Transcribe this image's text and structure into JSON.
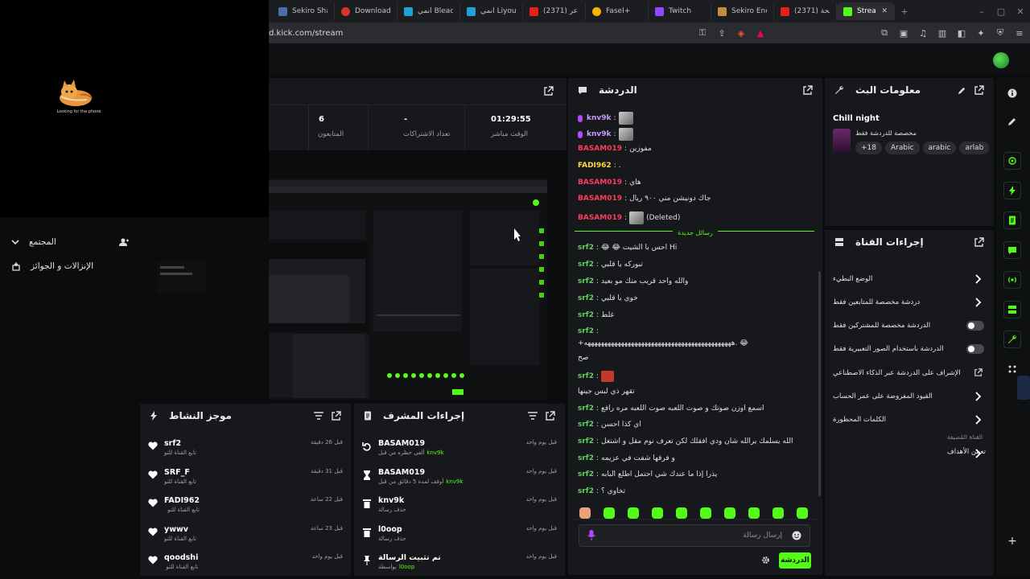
{
  "browser": {
    "tabs": [
      {
        "label": "Sekiro Shado",
        "color": "#4a6fa5"
      },
      {
        "label": "Download",
        "color": "#d9342b"
      },
      {
        "label": "انمي Bleach",
        "color": "#21a0d6"
      },
      {
        "label": "انمي Liyou)",
        "color": "#21a0d6"
      },
      {
        "label": "(2371) نكبنا عر",
        "color": "#e62117"
      },
      {
        "label": "Fasel+",
        "color": "#f4b400"
      },
      {
        "label": "Twitch",
        "color": "#9146ff"
      },
      {
        "label": "Sekiro Enemy",
        "color": "#c68d3c"
      },
      {
        "label": "(2371) واضحة",
        "color": "#e62117"
      },
      {
        "label": "Stream",
        "color": "#53fc18"
      }
    ],
    "url": "d.kick.com/stream"
  },
  "cam": {
    "caption": "Looking for the phone"
  },
  "leftnav": {
    "items": [
      {
        "label": "المجتمع"
      },
      {
        "label": "الإنزالات و الجوائز"
      }
    ]
  },
  "stats": {
    "items": [
      {
        "value": "01:29:55",
        "label": "الوقت مباشر"
      },
      {
        "value": "-",
        "label": "تعداد الاشتراكات"
      },
      {
        "value": "6",
        "label": "المتابعون"
      }
    ]
  },
  "chat": {
    "title": "الدردشة",
    "messages": [
      {
        "user": "knv9k",
        "color": "#c89cff",
        "text": "",
        "emote": true
      },
      {
        "user": "knv9k",
        "color": "#c89cff",
        "text": "",
        "emote": true
      },
      {
        "user": "BASAM019",
        "color": "#ff3b5c",
        "text": "مفوزين"
      },
      {
        "user": "FADI962",
        "color": "#ffd54a",
        "text": "."
      },
      {
        "user": "BASAM019",
        "color": "#ff3b5c",
        "text": "هاي"
      },
      {
        "user": "BASAM019",
        "color": "#ff3b5c",
        "text": "جاك دونيشن مني ٩٠٠ ريال"
      },
      {
        "user": "BASAM019",
        "color": "#ff3b5c",
        "text": "(Deleted)",
        "emote": true
      }
    ],
    "new_divider": "رسائل جديدة",
    "new_messages": [
      {
        "user": "srf2",
        "color": "#5fd35f",
        "text": "Hi احس با الشيت 😂 😂"
      },
      {
        "user": "srf2",
        "color": "#5fd35f",
        "text": "تبوركه يا قلبي"
      },
      {
        "user": "srf2",
        "color": "#5fd35f",
        "text": "والله واحد قريب منك مو بعيد"
      },
      {
        "user": "srf2",
        "color": "#5fd35f",
        "text": "خوي يا قلبي"
      },
      {
        "user": "srf2",
        "color": "#5fd35f",
        "text": "غلط"
      },
      {
        "user": "srf2",
        "color": "#5fd35f",
        "text": ""
      },
      {
        "user": "",
        "color": "#5fd35f",
        "text": "😂 .ههههههههههههههههههههههههههههههههههههههههههههه+"
      },
      {
        "user": "",
        "color": "#5fd35f",
        "text": "صح"
      },
      {
        "user": "srf2",
        "color": "#5fd35f",
        "text": "",
        "emote": true
      },
      {
        "user": "",
        "color": "#5fd35f",
        "text": "تقهر ذي لبس جينها"
      },
      {
        "user": "srf2",
        "color": "#5fd35f",
        "text": "اسمع اوزن صوتك و صوت اللعبه صوت اللعبه مره رافع"
      },
      {
        "user": "srf2",
        "color": "#5fd35f",
        "text": "اي كذا احسن"
      },
      {
        "user": "srf2",
        "color": "#5fd35f",
        "text": "الله يسلمك يرالله شان ودي افقلك لكن تعرف نوم مقل و اشتغل"
      },
      {
        "user": "srf2",
        "color": "#5fd35f",
        "text": "و فرقها شفت في عزيمه"
      },
      {
        "user": "srf2",
        "color": "#5fd35f",
        "text": "يذرا إذا ما عندك شي احتمل اطلع البابه"
      },
      {
        "user": "srf2",
        "color": "#5fd35f",
        "text": "تخاوي ؟"
      }
    ],
    "input_placeholder": "إرسال رسالة",
    "send_label": "الدردشة"
  },
  "info": {
    "title": "معلومات البث",
    "stream_title": "Chill night",
    "category": "مخصصة للدردشة فقط",
    "tags": [
      "+18",
      "Arabic",
      "arabic",
      "arlab"
    ]
  },
  "channel_actions": {
    "title": "إجراءات القناة",
    "items": [
      {
        "label": "الوضع البطيء",
        "control": "chevron"
      },
      {
        "label": "دردشة مخصصة للمتابعين فقط",
        "control": "chevron"
      },
      {
        "label": "الدردشة مخصصة للمشتركين فقط",
        "control": "toggle"
      },
      {
        "label": "الدردشة باستخدام الصور التعبيرية فقط",
        "control": "toggle"
      },
      {
        "label": "الإشراف على الدردشة عبر الذكاء الاصطناعي",
        "control": "external"
      },
      {
        "label": "القيود المفروضة على عمر الحساب",
        "control": "chevron"
      },
      {
        "label": "الكلمات المحظورة",
        "control": "chevron"
      }
    ],
    "section_label": "القناة المُضيفة",
    "target_label": "تعيين الأهداف"
  },
  "activity": {
    "title": "موجز النشاط",
    "items": [
      {
        "name": "srf2",
        "sub": "تابع القناة للتو",
        "time": "قبل 26 دقيقة"
      },
      {
        "name": "SRF_F",
        "sub": "تابع القناة للتو",
        "time": "قبل 31 دقيقة"
      },
      {
        "name": "FADI962",
        "sub": "تابع القناة للتو",
        "time": "قبل 22 ساعة"
      },
      {
        "name": "ywwv",
        "sub": "تابع القناة للتو",
        "time": "قبل 23 ساعة"
      },
      {
        "name": "qoodshi",
        "sub": "تابع القناة للتو",
        "time": "قبل يوم واحد"
      }
    ]
  },
  "mod_actions": {
    "title": "إجراءات المشرف",
    "items": [
      {
        "name": "BASAM019",
        "sub": "ألغى حظره من قبل",
        "target": "knv9k",
        "time": "قبل يوم واحد",
        "icon": "undo"
      },
      {
        "name": "BASAM019",
        "sub": "أوقف لمدة 5 دقائق من قبل",
        "target": "knv9k",
        "time": "قبل يوم واحد",
        "icon": "hourglass"
      },
      {
        "name": "knv9k",
        "sub": "حذف رسالة",
        "target": "",
        "time": "قبل يوم واحد",
        "icon": "trash"
      },
      {
        "name": "l0oop",
        "sub": "حذف رسالة",
        "target": "",
        "time": "قبل يوم واحد",
        "icon": "trash"
      },
      {
        "name": "تم تثبيت الرسالة",
        "sub": "بواسطة",
        "target": "l0oop",
        "time": "قبل يوم واحد",
        "icon": "pin"
      }
    ]
  },
  "colors": {
    "accent": "#53fc18",
    "panel": "#17181b",
    "bg": "#0b0c0e"
  }
}
